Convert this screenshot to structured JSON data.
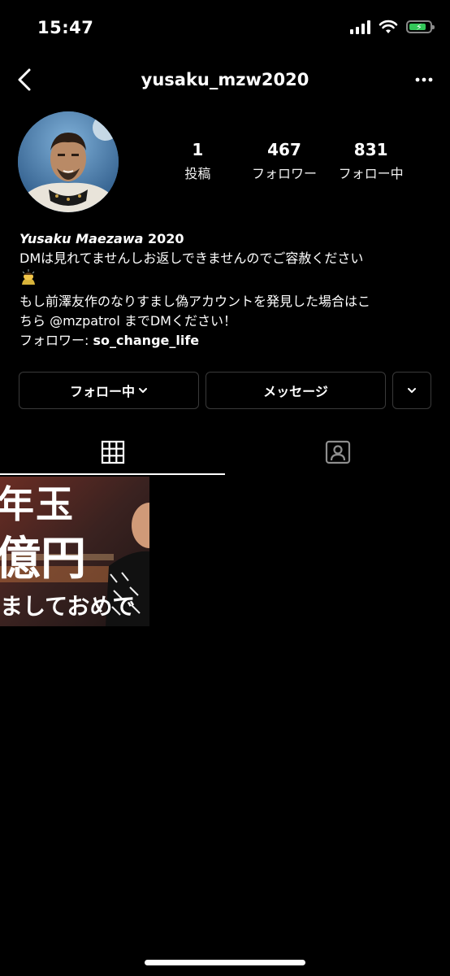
{
  "status_bar": {
    "time": "15:47"
  },
  "nav": {
    "title": "yusaku_mzw2020"
  },
  "stats": [
    {
      "value": "1",
      "label": "投稿"
    },
    {
      "value": "467",
      "label": "フォロワー"
    },
    {
      "value": "831",
      "label": "フォロー中"
    }
  ],
  "bio": {
    "name_italic": "Yusaku Maezawa",
    "name_suffix": " 2020",
    "line1": "DMは見れてませんしお返しできませんのでご容赦ください",
    "line2": "もし前澤友作のなりすまし偽アカウントを発見した場合はこ",
    "line3": "ちら @mzpatrol までDMください！",
    "followed_by_prefix": "フォロワー: ",
    "followed_by_user": "so_change_life"
  },
  "buttons": {
    "follow_label": "フォロー中",
    "message_label": "メッセージ"
  },
  "post": {
    "text_line1": "年玉",
    "text_line2": "億円",
    "text_line3": "ましておめで"
  }
}
